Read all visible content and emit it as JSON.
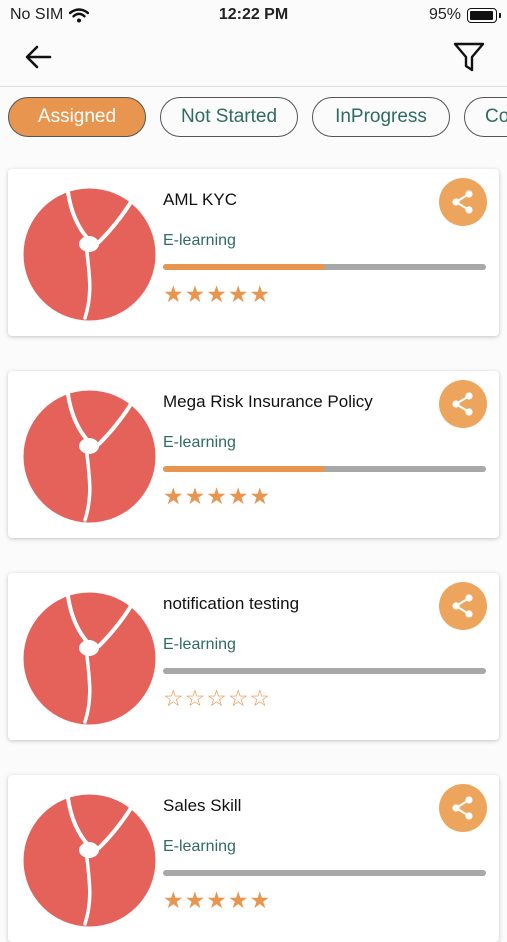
{
  "status_bar": {
    "carrier": "No SIM",
    "time": "12:22 PM",
    "battery": "95%"
  },
  "tabs": [
    {
      "label": "Assigned",
      "active": true
    },
    {
      "label": "Not Started",
      "active": false
    },
    {
      "label": "InProgress",
      "active": false
    },
    {
      "label": "Co",
      "active": false
    }
  ],
  "courses": [
    {
      "title": "AML KYC",
      "type": "E-learning",
      "progress": 0.5,
      "stars": "★★★★★"
    },
    {
      "title": "Mega Risk Insurance Policy",
      "type": "E-learning",
      "progress": 0.5,
      "stars": "★★★★★"
    },
    {
      "title": "notification testing",
      "type": "E-learning",
      "progress": 0,
      "stars": "☆☆☆☆☆"
    },
    {
      "title": "Sales Skill",
      "type": "E-learning",
      "progress": 0,
      "stars": "★★★★★"
    }
  ],
  "colors": {
    "accent": "#e8964f",
    "thumb": "#e4625a",
    "teal_text": "#2f6b62"
  },
  "icons": {
    "back": "arrow-left-icon",
    "filter": "filter-icon",
    "share": "share-icon",
    "wifi": "wifi-icon",
    "battery": "battery-icon"
  }
}
